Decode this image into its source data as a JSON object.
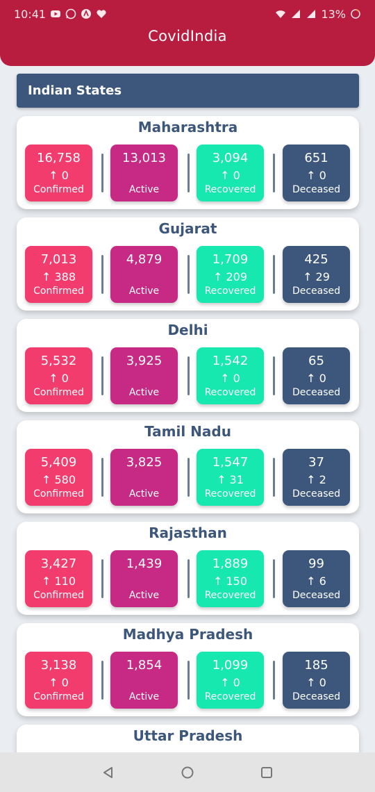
{
  "status_bar": {
    "time": "10:41",
    "battery": "13%",
    "icons_left": [
      "youtube-icon",
      "whatsapp-icon",
      "app-icon",
      "heart-icon"
    ],
    "icons_right": [
      "wifi-icon",
      "signal-icon",
      "signal-icon",
      "battery-icon"
    ]
  },
  "app": {
    "title": "CovidIndia"
  },
  "section": {
    "title": "Indian States"
  },
  "colors": {
    "appbar": "#b81c3f",
    "confirmed": "#f23c6e",
    "active": "#c62a84",
    "recovered": "#17e8af",
    "deceased": "#3d577c",
    "state_name": "#3d577c"
  },
  "labels": {
    "confirmed": "Confirmed",
    "active": "Active",
    "recovered": "Recovered",
    "deceased": "Deceased"
  },
  "states": [
    {
      "name": "Maharashtra",
      "confirmed": "16,758",
      "confirmed_delta": "↑ 0",
      "active": "13,013",
      "recovered": "3,094",
      "recovered_delta": "↑ 0",
      "deceased": "651",
      "deceased_delta": "↑ 0"
    },
    {
      "name": "Gujarat",
      "confirmed": "7,013",
      "confirmed_delta": "↑ 388",
      "active": "4,879",
      "recovered": "1,709",
      "recovered_delta": "↑ 209",
      "deceased": "425",
      "deceased_delta": "↑ 29"
    },
    {
      "name": "Delhi",
      "confirmed": "5,532",
      "confirmed_delta": "↑ 0",
      "active": "3,925",
      "recovered": "1,542",
      "recovered_delta": "↑ 0",
      "deceased": "65",
      "deceased_delta": "↑ 0"
    },
    {
      "name": "Tamil Nadu",
      "confirmed": "5,409",
      "confirmed_delta": "↑ 580",
      "active": "3,825",
      "recovered": "1,547",
      "recovered_delta": "↑ 31",
      "deceased": "37",
      "deceased_delta": "↑ 2"
    },
    {
      "name": "Rajasthan",
      "confirmed": "3,427",
      "confirmed_delta": "↑ 110",
      "active": "1,439",
      "recovered": "1,889",
      "recovered_delta": "↑ 150",
      "deceased": "99",
      "deceased_delta": "↑ 6"
    },
    {
      "name": "Madhya Pradesh",
      "confirmed": "3,138",
      "confirmed_delta": "↑ 0",
      "active": "1,854",
      "recovered": "1,099",
      "recovered_delta": "↑ 0",
      "deceased": "185",
      "deceased_delta": "↑ 0"
    },
    {
      "name": "Uttar Pradesh"
    }
  ],
  "nav": {
    "icons": [
      "back-icon",
      "home-icon",
      "recents-icon"
    ]
  }
}
